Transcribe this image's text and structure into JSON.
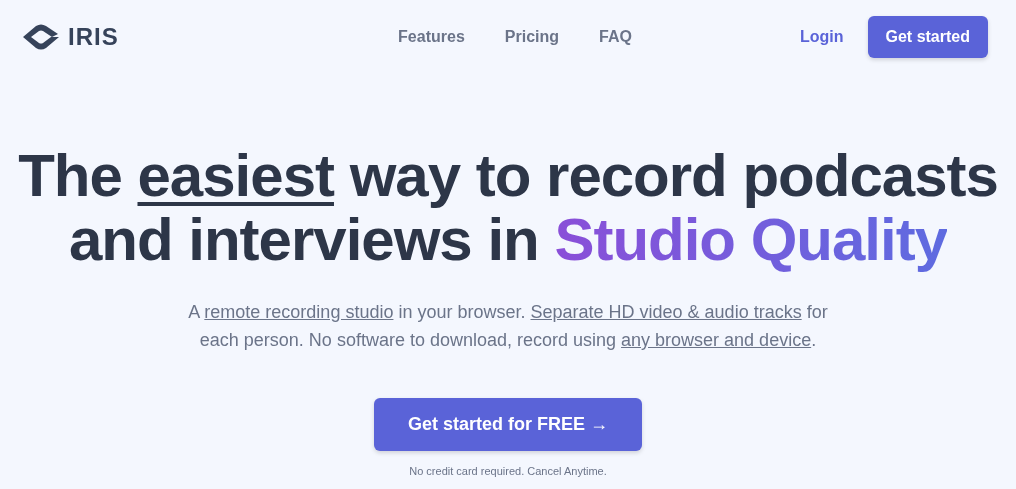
{
  "brand": {
    "name": "IRIS"
  },
  "nav": [
    {
      "label": "Features"
    },
    {
      "label": "Pricing"
    },
    {
      "label": "FAQ"
    }
  ],
  "auth": {
    "login": "Login",
    "cta": "Get started"
  },
  "headline": {
    "lines": [
      [
        {
          "kind": "plain",
          "text": "The "
        },
        {
          "kind": "underline",
          "text": "easiest"
        },
        {
          "kind": "plain",
          "text": " way to record podcasts"
        }
      ],
      [
        {
          "kind": "plain",
          "text": "and interviews in "
        },
        {
          "kind": "gradient",
          "text": "Studio Quality"
        }
      ]
    ]
  },
  "subtitle": {
    "lines": [
      [
        {
          "kind": "plain",
          "text": "A "
        },
        {
          "kind": "link",
          "text": "remote recording studio"
        },
        {
          "kind": "plain",
          "text": " in your browser. "
        },
        {
          "kind": "link",
          "text": "Separate HD video & audio tracks"
        },
        {
          "kind": "plain",
          "text": " for"
        }
      ],
      [
        {
          "kind": "plain",
          "text": "each person. No software to download, record using "
        },
        {
          "kind": "link",
          "text": "any browser and device"
        },
        {
          "kind": "plain",
          "text": "."
        }
      ]
    ]
  },
  "hero_cta": {
    "label": "Get started for FREE →",
    "note": "No credit card required. Cancel Anytime."
  }
}
